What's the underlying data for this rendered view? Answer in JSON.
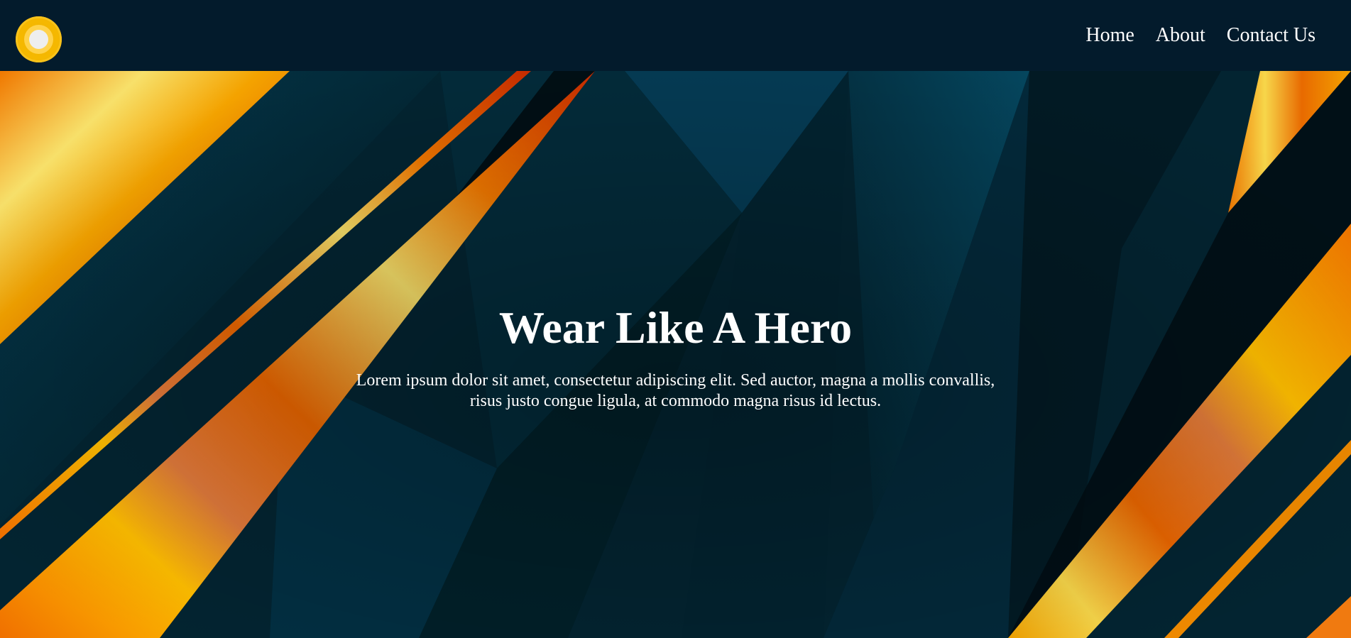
{
  "navbar": {
    "logo_icon": "circle-logo-icon",
    "links": [
      {
        "label": "Home"
      },
      {
        "label": "About"
      },
      {
        "label": "Contact Us"
      }
    ]
  },
  "hero": {
    "title": "Wear Like A Hero",
    "subtitle": "Lorem ipsum dolor sit amet, consectetur adipiscing elit. Sed auctor, magna a mollis convallis, risus justo congue ligula, at commodo magna risus id lectus."
  },
  "colors": {
    "navbar_bg": "#031b2c",
    "hero_bg": "#03222f",
    "accent_orange": "#f07a00",
    "accent_yellow": "#f7c63a",
    "text": "#ffffff"
  }
}
